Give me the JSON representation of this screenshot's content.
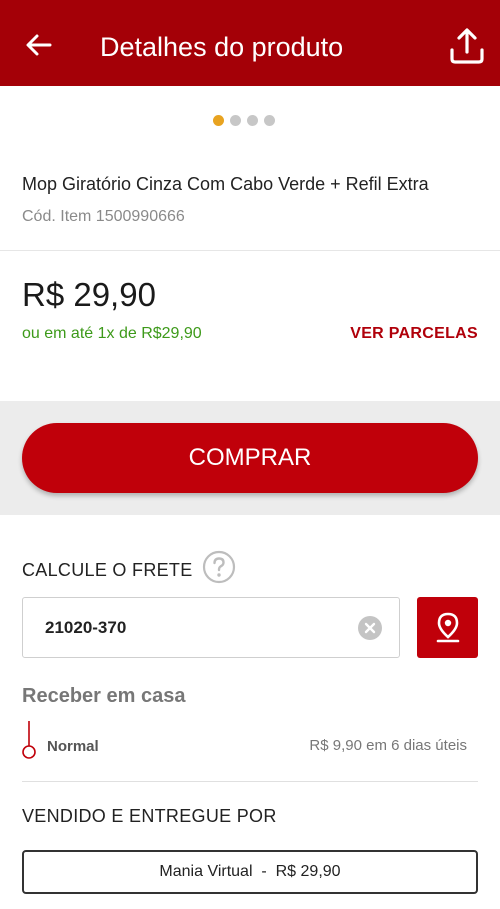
{
  "header": {
    "title": "Detalhes do produto",
    "back_icon": "arrow-left-icon",
    "share_icon": "share-upload-icon",
    "color": "#a40007"
  },
  "carousel": {
    "page_count": 4,
    "active_index": 0,
    "active_color": "#e8a320"
  },
  "product": {
    "name": "Mop Giratório Cinza Com Cabo Verde + Refil Extra",
    "code": "Cód. Item 1500990666"
  },
  "pricing": {
    "price": "R$ 29,90",
    "installments": "ou em até 1x de R$29,90",
    "installments_link": "VER PARCELAS",
    "installments_color": "#3d9a1a"
  },
  "buy": {
    "label": "COMPRAR",
    "color": "#c0000a"
  },
  "freight": {
    "label": "CALCULE O FRETE",
    "help_icon": "question-circle-icon",
    "cep_value": "21020-370",
    "clear_icon": "clear-circle-icon",
    "location_icon": "map-pin-icon",
    "receive_title": "Receber em casa",
    "options": [
      {
        "label": "Normal",
        "price": "R$ 9,90 em 6 dias úteis"
      }
    ]
  },
  "seller": {
    "label": "VENDIDO E ENTREGUE POR",
    "name": "Mania Virtual",
    "separator": "-",
    "price": "R$ 29,90"
  }
}
